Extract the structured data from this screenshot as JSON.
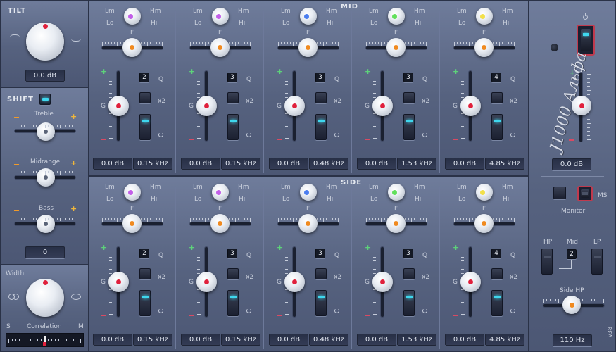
{
  "colors": {
    "accent": "#3fd7ee",
    "plus": "#5dd27a",
    "minus": "#d94a63",
    "knob_dot_center": "#f08a20",
    "gain_dot": "#e0203c"
  },
  "left": {
    "tilt": {
      "title": "TILT",
      "readout": "0.0 dB"
    },
    "shift": {
      "title": "SHIFT",
      "treble": "Treble",
      "midrange": "Midrange",
      "bass": "Bass",
      "readout": "0"
    },
    "width": {
      "label": "Width",
      "correlation": "Correlation",
      "s": "S",
      "m": "M"
    }
  },
  "sections": [
    {
      "title": "MID",
      "bands": [
        {
          "q": "2",
          "gain": "0.0 dB",
          "freq": "0.15 kHz",
          "color": "#c25ee8"
        },
        {
          "q": "3",
          "gain": "0.0 dB",
          "freq": "0.15 kHz",
          "color": "#c25ee8"
        },
        {
          "q": "3",
          "gain": "0.0 dB",
          "freq": "0.48 kHz",
          "color": "#4a7df0"
        },
        {
          "q": "3",
          "gain": "0.0 dB",
          "freq": "1.53 kHz",
          "color": "#62e05c"
        },
        {
          "q": "4",
          "gain": "0.0 dB",
          "freq": "4.85 kHz",
          "color": "#f2e04a"
        }
      ]
    },
    {
      "title": "SIDE",
      "bands": [
        {
          "q": "2",
          "gain": "0.0 dB",
          "freq": "0.15 kHz",
          "color": "#c25ee8"
        },
        {
          "q": "3",
          "gain": "0.0 dB",
          "freq": "0.15 kHz",
          "color": "#c25ee8"
        },
        {
          "q": "3",
          "gain": "0.0 dB",
          "freq": "0.48 kHz",
          "color": "#4a7df0"
        },
        {
          "q": "3",
          "gain": "0.0 dB",
          "freq": "1.53 kHz",
          "color": "#62e05c"
        },
        {
          "q": "4",
          "gain": "0.0 dB",
          "freq": "4.85 kHz",
          "color": "#f2e04a"
        }
      ]
    }
  ],
  "band_labels": {
    "lm": "Lm",
    "hm": "Hm",
    "lo": "Lo",
    "hi": "Hi",
    "f": "F",
    "g": "G",
    "q": "Q",
    "x2": "x2"
  },
  "right": {
    "logo": "J1000 Альфа",
    "gain_readout": "0.0 dB",
    "monitor_label": "Monitor",
    "ms_label": "MS",
    "hp_label": "HP",
    "mid_label": "Mid",
    "lp_label": "LP",
    "mid_value": "2",
    "side_hp_label": "Side HP",
    "side_hp_readout": "110 Hz",
    "version": "v38"
  }
}
